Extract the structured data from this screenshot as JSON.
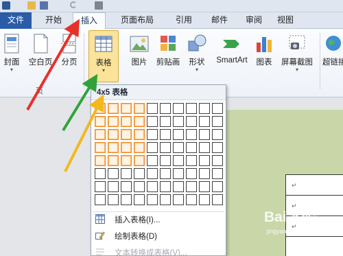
{
  "tabs": [
    "文件",
    "开始",
    "插入",
    "页面布局",
    "引用",
    "邮件",
    "审阅",
    "视图"
  ],
  "active_tab": "插入",
  "ribbon": {
    "buttons": [
      "封面",
      "空白页",
      "分页",
      "表格",
      "图片",
      "剪贴画",
      "形状",
      "SmartArt",
      "图表",
      "屏幕截图",
      "超链接"
    ],
    "group_pages_label": "页"
  },
  "table_menu": {
    "title": "4x5 表格",
    "grid_cols": 10,
    "grid_rows": 8,
    "selected_cols": 4,
    "selected_rows": 5,
    "items": [
      {
        "label": "插入表格(I)...",
        "icon": "insert-table-icon",
        "enabled": true
      },
      {
        "label": "绘制表格(D)",
        "icon": "draw-table-icon",
        "enabled": true
      },
      {
        "label": "文本转换成表格(V)...",
        "icon": "convert-text-icon",
        "enabled": false
      }
    ]
  },
  "document": {
    "paragraph_marks": [
      "↵",
      "↵",
      "↵"
    ]
  },
  "watermark": {
    "main": "Bai 经验",
    "sub": "jingyan.baidu.com"
  },
  "arrow_colors": {
    "red": "#e8302a",
    "green": "#2fa33a",
    "yellow": "#f4b81c"
  }
}
